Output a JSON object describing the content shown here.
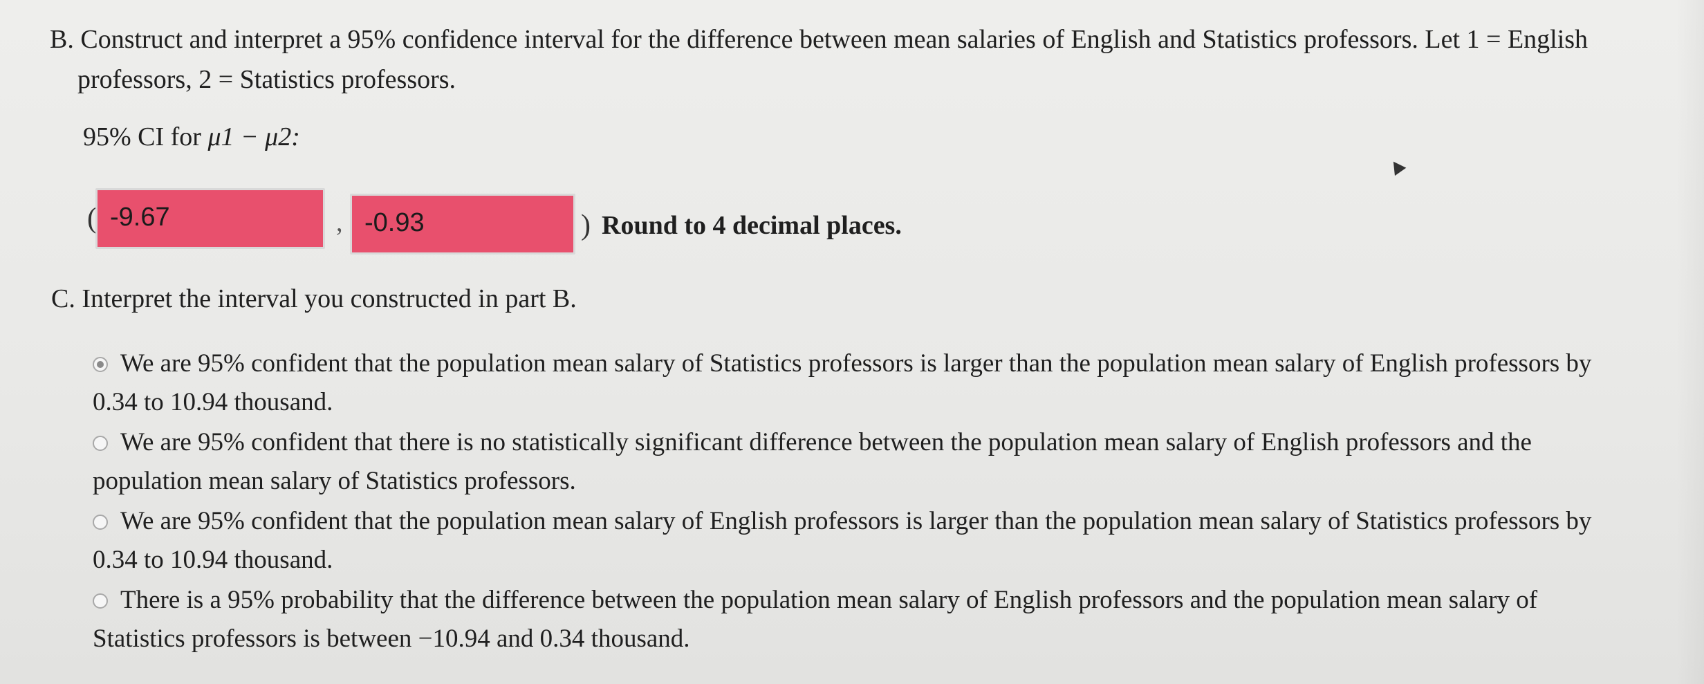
{
  "part_b": {
    "line1": "B. Construct and interpret a 95% confidence interval for the difference between mean salaries of English and Statistics professors. Let 1 = English",
    "line2": "professors, 2 = Statistics professors.",
    "ci_label_prefix": "95% CI for ",
    "ci_label_math": "μ1 − μ2:",
    "open_paren": "(",
    "comma": ",",
    "close_paren": ")",
    "lower_value": "-9.67",
    "upper_value": "-0.93",
    "round_note": "Round to 4 decimal places."
  },
  "part_c": {
    "heading": "C. Interpret the interval you constructed in part B.",
    "options": [
      {
        "text": "We are 95% confident that the population mean salary of Statistics professors is larger than the population mean salary of English professors by 0.34 to 10.94 thousand.",
        "selected": true
      },
      {
        "text": "We are 95% confident that there is no statistically significant difference between the population mean salary of English professors and the population mean salary of Statistics professors.",
        "selected": false
      },
      {
        "text": "We are 95% confident that the population mean salary of English professors is larger than the population mean salary of Statistics professors by 0.34 to 10.94 thousand.",
        "selected": false
      },
      {
        "text": "There is a 95% probability that the difference between the population mean salary of English professors and the population mean salary of Statistics professors is between −10.94 and 0.34 thousand.",
        "selected": false
      }
    ]
  },
  "colors": {
    "incorrect_field": "#e8506d",
    "page_background": "#eeeeec"
  }
}
